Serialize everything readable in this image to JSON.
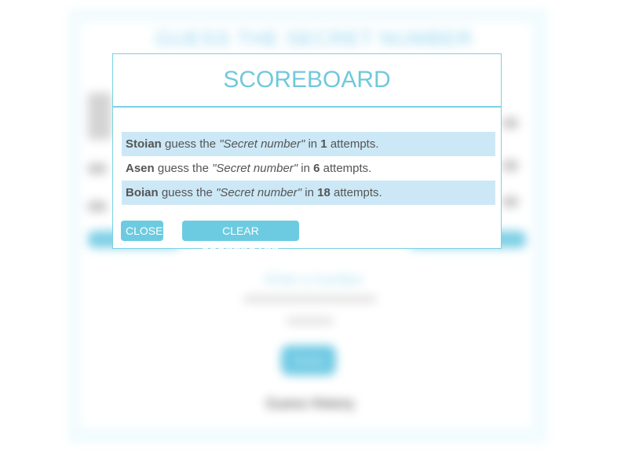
{
  "background": {
    "title": "GUESS THE SECRET NUMBER",
    "input_text": "Enter a number",
    "button_label": "Guess",
    "footer_text": "Guess History"
  },
  "modal": {
    "title": "SCOREBOARD",
    "rows": [
      {
        "player": "Stoian",
        "mid": "guess the",
        "secret": "\"Secret number\"",
        "in": "in",
        "attempts": "1",
        "tail": "attempts."
      },
      {
        "player": "Asen",
        "mid": "guess the",
        "secret": "\"Secret number\"",
        "in": "in",
        "attempts": "6",
        "tail": "attempts."
      },
      {
        "player": "Boian",
        "mid": "guess the",
        "secret": "\"Secret number\"",
        "in": "in",
        "attempts": "18",
        "tail": "attempts."
      }
    ],
    "close_label": "CLOSE",
    "clear_label": "CLEAR SCOREBOARD"
  },
  "colors": {
    "accent": "#6ccbe0",
    "title": "#72c8dc",
    "row_highlight": "#cce8f6",
    "border": "#7ad1e3"
  }
}
